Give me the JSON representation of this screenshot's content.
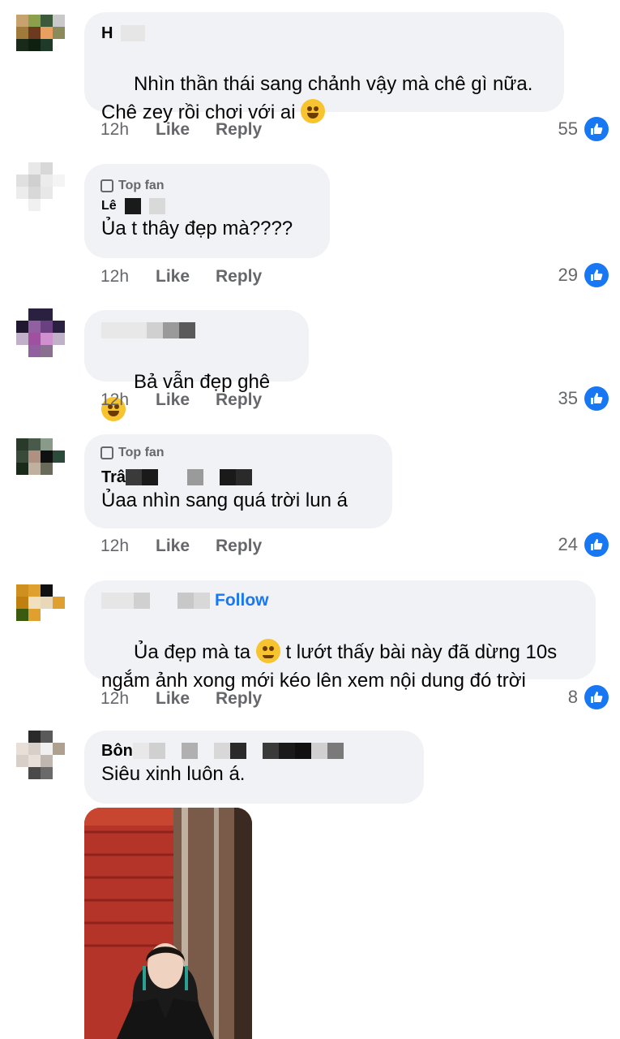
{
  "comments": [
    {
      "name": "H",
      "text": "Nhìn thần thái sang chảnh vậy mà chê gì nữa.\nChê zey rồi chơi với ai",
      "emoji": "star-struck-emoji",
      "time": "12h",
      "like": "Like",
      "reply": "Reply",
      "count": "55"
    },
    {
      "badge": "Top fan",
      "name": "Lê",
      "text": "Ủa t thây đẹp mà????",
      "time": "12h",
      "like": "Like",
      "reply": "Reply",
      "count": "29"
    },
    {
      "name": "",
      "text": "Bả vẫn đẹp ghê",
      "emoji": "laughing-tears-emoji",
      "time": "12h",
      "like": "Like",
      "reply": "Reply",
      "count": "35"
    },
    {
      "badge": "Top fan",
      "name": "Trâ",
      "text": "Ủaa nhìn sang quá trời lun á",
      "time": "12h",
      "like": "Like",
      "reply": "Reply",
      "count": "24"
    },
    {
      "name": "",
      "follow": "Follow",
      "text_a": "Ủa đẹp mà ta",
      "text_b": " t lướt thấy bài này đã dừng 10s\nngắm ảnh xong mới kéo lên xem nội dung đó trời",
      "emoji": "pleading-face-emoji",
      "time": "12h",
      "like": "Like",
      "reply": "Reply",
      "count": "8"
    },
    {
      "name": "Bôn",
      "text": "Siêu xinh luôn á."
    }
  ],
  "icons": {
    "like": "like-thumb-icon",
    "badge": "globe-icon"
  },
  "colors": {
    "accent": "#1877f2",
    "bubble": "#f0f2f5",
    "muted": "#65676b"
  }
}
